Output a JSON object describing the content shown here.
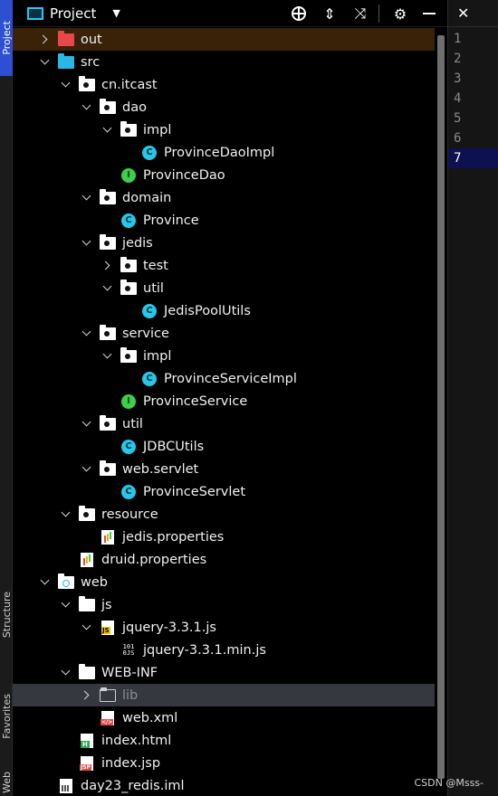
{
  "sidebar": {
    "project_tab": "Project",
    "structure_tab": "Structure",
    "favorites_tab": "Favorites",
    "web_tab": "Web"
  },
  "toolbar": {
    "title": "Project",
    "dropdown_icon": "caret-down-icon",
    "buttons": [
      "locate-icon",
      "expand-all-icon",
      "collapse-all-icon",
      "gear-icon",
      "hide-icon"
    ]
  },
  "tree": [
    {
      "label": "out",
      "icon": "folder-red-icon",
      "depth": 1,
      "expander": "right",
      "highlight": "excluded"
    },
    {
      "label": "src",
      "icon": "folder-source-icon",
      "depth": 1,
      "expander": "down"
    },
    {
      "label": "cn.itcast",
      "icon": "package-icon",
      "depth": 2,
      "expander": "down"
    },
    {
      "label": "dao",
      "icon": "package-icon",
      "depth": 3,
      "expander": "down"
    },
    {
      "label": "impl",
      "icon": "package-icon",
      "depth": 4,
      "expander": "down"
    },
    {
      "label": "ProvinceDaoImpl",
      "icon": "class-icon",
      "depth": 5
    },
    {
      "label": "ProvinceDao",
      "icon": "interface-icon",
      "depth": 4
    },
    {
      "label": "domain",
      "icon": "package-icon",
      "depth": 3,
      "expander": "down"
    },
    {
      "label": "Province",
      "icon": "class-icon",
      "depth": 4
    },
    {
      "label": "jedis",
      "icon": "package-icon",
      "depth": 3,
      "expander": "down"
    },
    {
      "label": "test",
      "icon": "package-icon",
      "depth": 4,
      "expander": "right"
    },
    {
      "label": "util",
      "icon": "package-icon",
      "depth": 4,
      "expander": "down"
    },
    {
      "label": "JedisPoolUtils",
      "icon": "class-icon",
      "depth": 5
    },
    {
      "label": "service",
      "icon": "package-icon",
      "depth": 3,
      "expander": "down"
    },
    {
      "label": "impl",
      "icon": "package-icon",
      "depth": 4,
      "expander": "down"
    },
    {
      "label": "ProvinceServiceImpl",
      "icon": "class-icon",
      "depth": 5
    },
    {
      "label": "ProvinceService",
      "icon": "interface-icon",
      "depth": 4
    },
    {
      "label": "util",
      "icon": "package-icon",
      "depth": 3,
      "expander": "down"
    },
    {
      "label": "JDBCUtils",
      "icon": "class-icon",
      "depth": 4
    },
    {
      "label": "web.servlet",
      "icon": "package-icon",
      "depth": 3,
      "expander": "down"
    },
    {
      "label": "ProvinceServlet",
      "icon": "class-icon",
      "depth": 4
    },
    {
      "label": "resource",
      "icon": "package-icon",
      "depth": 2,
      "expander": "down"
    },
    {
      "label": "jedis.properties",
      "icon": "properties-file-icon",
      "depth": 3
    },
    {
      "label": "druid.properties",
      "icon": "properties-file-icon",
      "depth": 2
    },
    {
      "label": "web",
      "icon": "folder-web-icon",
      "depth": 1,
      "expander": "down"
    },
    {
      "label": "js",
      "icon": "folder-icon",
      "depth": 2,
      "expander": "down"
    },
    {
      "label": "jquery-3.3.1.js",
      "icon": "js-file-icon",
      "depth": 3,
      "expander": "down"
    },
    {
      "label": "jquery-3.3.1.min.js",
      "icon": "min-js-file-icon",
      "depth": 4
    },
    {
      "label": "WEB-INF",
      "icon": "folder-icon",
      "depth": 2,
      "expander": "down"
    },
    {
      "label": "lib",
      "icon": "folder-hollow-icon",
      "depth": 3,
      "expander": "right",
      "highlight": "selected",
      "dim": true
    },
    {
      "label": "web.xml",
      "icon": "xml-file-icon",
      "depth": 3
    },
    {
      "label": "index.html",
      "icon": "html-file-icon",
      "depth": 2
    },
    {
      "label": "index.jsp",
      "icon": "jsp-file-icon",
      "depth": 2
    },
    {
      "label": "day23_redis.iml",
      "icon": "iml-file-icon",
      "depth": 1
    }
  ],
  "editor": {
    "close_tab": "✕",
    "line_numbers": [
      "1",
      "2",
      "3",
      "4",
      "5",
      "6",
      "7"
    ],
    "current_line": "7"
  },
  "watermark": "CSDN @Msss-"
}
